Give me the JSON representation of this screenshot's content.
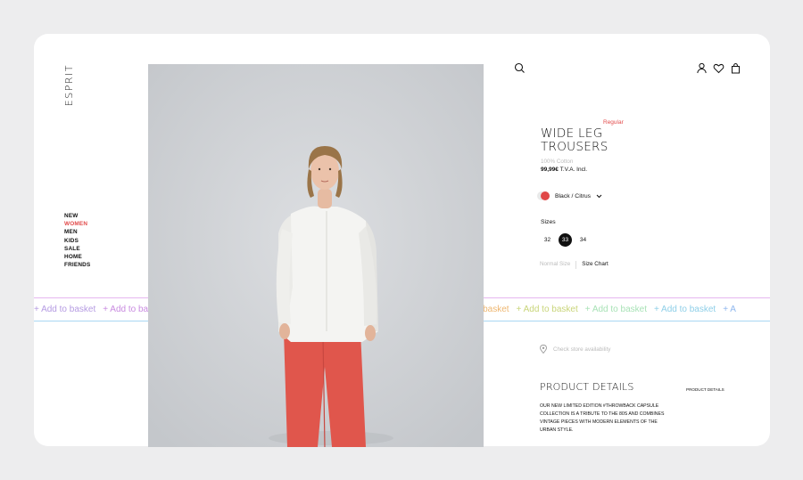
{
  "brand": {
    "logo": "ESPRIT"
  },
  "nav": {
    "items": [
      "NEW",
      "WOMEN",
      "MEN",
      "KIDS",
      "SALE",
      "HOME",
      "FRIENDS"
    ],
    "active_index": 1
  },
  "header_icons": [
    "search-icon",
    "user-icon",
    "heart-icon",
    "bag-icon"
  ],
  "marquee": {
    "items": [
      "+ Add to basket",
      "+ Add to basket",
      "+ Add to basket",
      "+ Add to basket",
      "+ Add to basket",
      "+ Add to basket",
      "+ Add to basket",
      "+ Add to basket",
      "+ Add to basket",
      "+ Add to basket",
      "+ A"
    ],
    "colors": [
      "#b59be2",
      "#c98be0",
      "#d98ad4",
      "#e48fb7",
      "#e9967f",
      "#f0a37a",
      "#eeb670",
      "#c9d57a",
      "#a8e2b6",
      "#8fcfe8",
      "#8fb7ee"
    ]
  },
  "product": {
    "tag": "Regular",
    "title_line1": "WIDE LEG",
    "title_line2": "TROUSERS",
    "material": "100% Cotton",
    "price": "99,99€",
    "price_suffix": "T.V.A. Incl.",
    "color": "Black / Citrus",
    "sizes_label": "Sizes",
    "sizes": [
      "32",
      "33",
      "34"
    ],
    "selected_size": "33",
    "fit_normal": "Normal Size",
    "size_chart": "Size Chart",
    "store_check": "Check store availability"
  },
  "details": {
    "title": "PRODUCT DETAILS",
    "side_label": "PRODUCT DETAILS",
    "text": "OUR NEW LIMITED EDITION #THROWBACK CAPSULE COLLECTION IS A TRIBUTE TO THE 80S AND COMBINES VINTAGE PIECES WITH MODERN ELEMENTS OF THE URBAN STYLE."
  },
  "colors": {
    "accent": "#e24b4b",
    "pants": "#e0564c"
  }
}
